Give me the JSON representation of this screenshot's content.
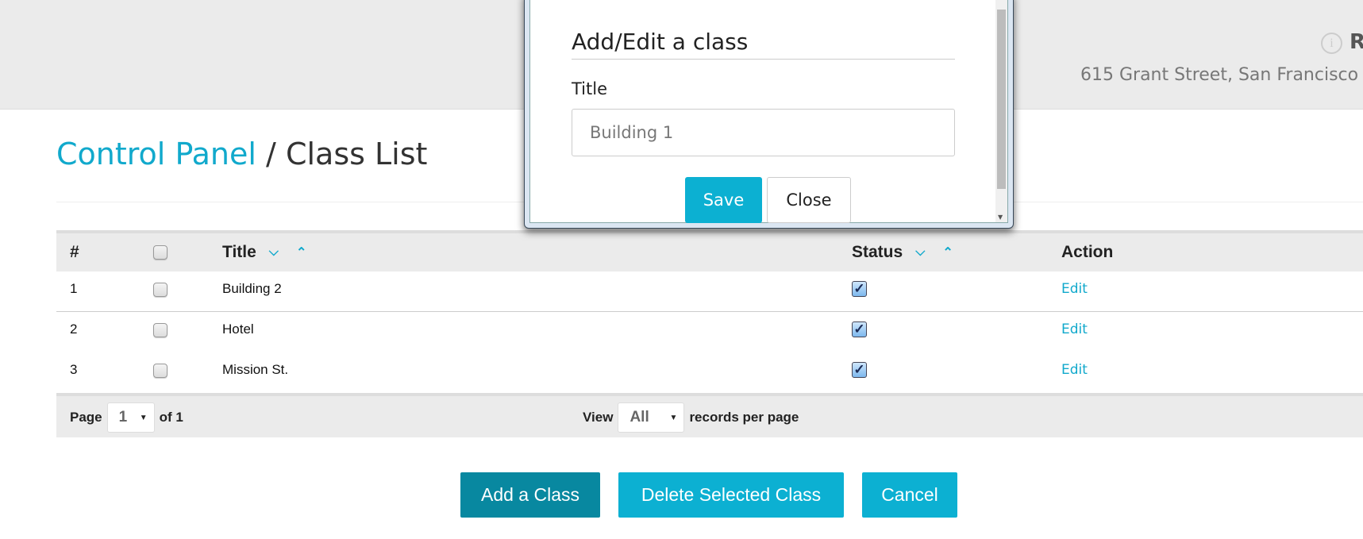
{
  "header": {
    "name_initial": "R",
    "address": "615 Grant Street, San Francisco",
    "info_icon": "info-circle-icon"
  },
  "breadcrumb": {
    "link": "Control Panel",
    "separator": " / ",
    "current": "Class List"
  },
  "table": {
    "columns": {
      "num": "#",
      "title": "Title",
      "status": "Status",
      "action": "Action"
    },
    "sort_down": "⌄",
    "sort_up": "⌃",
    "rows": [
      {
        "num": "1",
        "title": "Building 2",
        "status": true,
        "action": "Edit"
      },
      {
        "num": "2",
        "title": "Hotel",
        "status": true,
        "action": "Edit"
      },
      {
        "num": "3",
        "title": "Mission St.",
        "status": true,
        "action": "Edit"
      }
    ],
    "footer": {
      "page_label": "Page",
      "page_value": "1",
      "of_label": "of 1",
      "view_label": "View",
      "view_value": "All",
      "per_page_label": "records per page"
    }
  },
  "buttons": {
    "add": "Add a Class",
    "delete": "Delete Selected Class",
    "cancel": "Cancel"
  },
  "modal": {
    "heading": "Add/Edit a class",
    "title_label": "Title",
    "title_value": "Building 1",
    "save": "Save",
    "close": "Close"
  },
  "colors": {
    "accent": "#11a9cc",
    "add_button": "#0888a0",
    "button": "#0cb0d2",
    "header_bg": "#ebebeb"
  }
}
